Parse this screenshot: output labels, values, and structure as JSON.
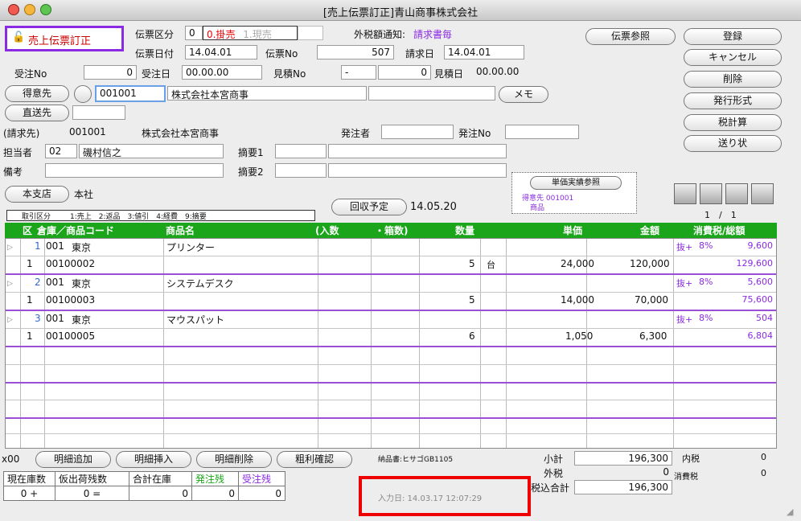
{
  "window": {
    "title": "[売上伝票訂正]青山商事株式会社"
  },
  "mode": {
    "label": "売上伝票訂正"
  },
  "header": {
    "denpyo_kubun_label": "伝票区分",
    "denpyo_kubun_value": "0",
    "kake_label": "0.掛売",
    "genbai_label": "1.現売",
    "zeigaku_label": "外税額通知:",
    "zeigaku_value": "請求書毎",
    "denpyo_date_label": "伝票日付",
    "denpyo_date": "14.04.01",
    "denpyo_no_label": "伝票No",
    "denpyo_no": "507",
    "seikyu_label": "請求日",
    "seikyu_date": "14.04.01",
    "juchu_no_label": "受注No",
    "juchu_no": "0",
    "juchu_date_label": "受注日",
    "juchu_date": "00.00.00",
    "mitsumori_no_label": "見積No",
    "mitsumori_no_a": "-",
    "mitsumori_no": "0",
    "mitsumori_date_label": "見積日",
    "mitsumori_date": "00.00.00",
    "tokuisaki_btn": "得意先",
    "tokuisaki_code": "001001",
    "tokuisaki_name": "株式会社本宮商事",
    "memo_btn": "メモ",
    "chokuso_btn": "直送先",
    "seikyusaki_label": "(請求先)",
    "seikyusaki_code": "001001",
    "seikyusaki_name": "株式会社本宮商事",
    "hacchusha_label": "発注者",
    "hacchu_no_label": "発注No",
    "tantosha_label": "担当者",
    "tantosha_code": "02",
    "tantosha_name": "磯村信之",
    "tekiyo1_label": "摘要1",
    "biko_label": "備考",
    "tekiyo2_label": "摘要2",
    "honshiten_btn": "本支店",
    "honshiten_value": "本社",
    "torihiki_label": "取引区分",
    "torihiki_desc": "1:売上　2:返品　3:値引　4:経費　9:摘要",
    "kaishu_btn": "回収予定",
    "kaishu_date": "14.05.20",
    "tanka_btn": "単価実績参照",
    "tanka_tokui": "得意先 001001",
    "tanka_shohin": "商品",
    "page_indicator": "1　/　1"
  },
  "right_buttons": {
    "denpyo_sansho": "伝票参照",
    "toroku": "登録",
    "cancel": "キャンセル",
    "sakujo": "削除",
    "hakko": "発行形式",
    "zei": "税計算",
    "okurijo": "送り状"
  },
  "grid": {
    "headers": {
      "ku": "区",
      "code": "倉庫／商品コード",
      "name": "商品名",
      "irisu": "(入数",
      "hakosu": "・箱数)",
      "suryo": "数量",
      "tanka": "単価",
      "kingaku": "金額",
      "zei": "消費税/総額"
    },
    "rows": [
      {
        "line": "1",
        "soko": "001",
        "soko_name": "東京",
        "name": "プリンター",
        "kubun": "1",
        "code": "00100002",
        "qty": "5",
        "unit": "台",
        "price": "24,000",
        "amount": "120,000",
        "tax_type": "抜+",
        "tax_rate": "8%",
        "tax": "9,600",
        "total": "129,600"
      },
      {
        "line": "2",
        "soko": "001",
        "soko_name": "東京",
        "name": "システムデスク",
        "kubun": "1",
        "code": "00100003",
        "qty": "5",
        "unit": "",
        "price": "14,000",
        "amount": "70,000",
        "tax_type": "抜+",
        "tax_rate": "8%",
        "tax": "5,600",
        "total": "75,600"
      },
      {
        "line": "3",
        "soko": "001",
        "soko_name": "東京",
        "name": "マウスパット",
        "kubun": "1",
        "code": "00100005",
        "qty": "6",
        "unit": "",
        "price": "1,050",
        "amount": "6,300",
        "tax_type": "抜+",
        "tax_rate": "8%",
        "tax": "504",
        "total": "6,804"
      }
    ]
  },
  "footer": {
    "x00": "x00",
    "add_btn": "明細追加",
    "insert_btn": "明細挿入",
    "delete_btn": "明細削除",
    "arari_btn": "粗利確認",
    "nohinsho": "納品書:ヒサゴGB1105",
    "shokei_label": "小計",
    "shokei": "196,300",
    "uchizei_label": "内税",
    "uchizei": "0",
    "sotozei_label": "外税",
    "sotozei": "0",
    "shohizei_label": "消費税",
    "shohizei": "0",
    "zeikomi_label": "税込合計",
    "zeikomi": "196,300",
    "stock_headers": [
      "現在庫数",
      "仮出荷残数",
      "合計在庫",
      "発注残",
      "受注残"
    ],
    "stock_values": [
      "0 +",
      "0 =",
      "0",
      "0",
      "0"
    ],
    "input_date": "入力日: 14.03.17 12:07:29"
  },
  "colors": {
    "grid_header": "#1aa51a",
    "accent_purple": "#8a2be2",
    "highlight_red": "#e00000"
  }
}
